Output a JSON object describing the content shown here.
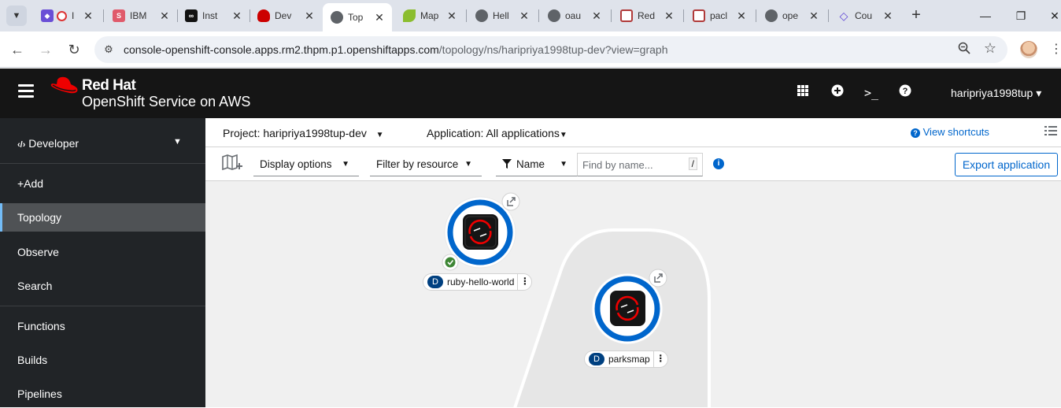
{
  "browser": {
    "tabs": [
      {
        "title": "I",
        "color": "#6a4fd6",
        "active": false
      },
      {
        "title": "IBM",
        "color": "#e05a6b",
        "active": false
      },
      {
        "title": "Inst",
        "color": "#111111",
        "active": false
      },
      {
        "title": "Dev",
        "color": "#cc0000",
        "active": false
      },
      {
        "title": "Top",
        "color": "#5f6368",
        "active": true
      },
      {
        "title": "Map",
        "color": "#8bbd2f",
        "active": false
      },
      {
        "title": "Hell",
        "color": "#5f6368",
        "active": false
      },
      {
        "title": "oau",
        "color": "#5f6368",
        "active": false
      },
      {
        "title": "Red",
        "color": "#b03a3a",
        "active": false
      },
      {
        "title": "pacl",
        "color": "#b03a3a",
        "active": false
      },
      {
        "title": "ope",
        "color": "#5f6368",
        "active": false
      },
      {
        "title": "Cou",
        "color": "#5a3fd6",
        "active": false
      }
    ],
    "url_host": "console-openshift-console.apps.rm2.thpm.p1.openshiftapps.com",
    "url_path": "/topology/ns/haripriya1998tup-dev?view=graph"
  },
  "masthead": {
    "brand_line1": "Red Hat",
    "brand_line2": "OpenShift Service on AWS",
    "user": "haripriya1998tup"
  },
  "sidebar": {
    "perspective": "Developer",
    "items": [
      {
        "label": "+Add",
        "active": false
      },
      {
        "label": "Topology",
        "active": true
      },
      {
        "label": "Observe",
        "active": false
      },
      {
        "label": "Search",
        "active": false
      },
      {
        "label": "Functions",
        "active": false
      },
      {
        "label": "Builds",
        "active": false
      },
      {
        "label": "Pipelines",
        "active": false
      }
    ]
  },
  "project_bar": {
    "project": "Project: haripriya1998tup-dev",
    "application": "Application: All applications",
    "shortcuts": "View shortcuts"
  },
  "toolbar": {
    "display_options": "Display options",
    "filter_by_resource": "Filter by resource",
    "filter_type": "Name",
    "search_placeholder": "Find by name...",
    "slash_key": "/",
    "export": "Export application"
  },
  "topology": {
    "nodes": [
      {
        "name": "ruby-hello-world",
        "kind": "D",
        "status": "ok"
      },
      {
        "name": "parksmap",
        "kind": "D",
        "status": ""
      }
    ]
  },
  "colors": {
    "masthead": "#151515",
    "sidebar": "#212427",
    "link": "#0066cc",
    "node_ring": "#0066cc",
    "success": "#3e8635"
  }
}
